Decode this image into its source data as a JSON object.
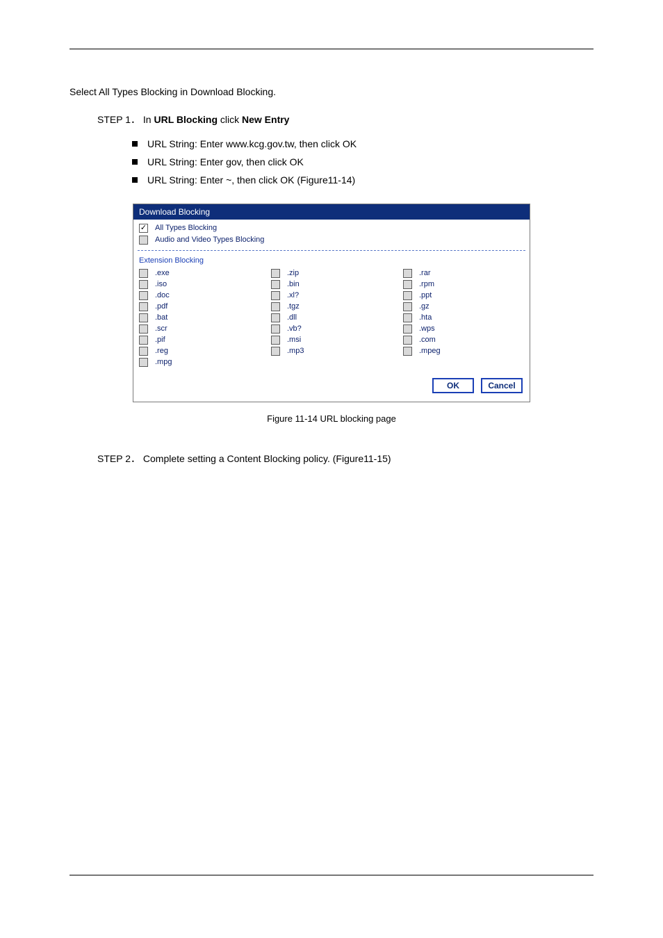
{
  "caption": "Figure 11-14  URL blocking page",
  "intro": "Select All Types Blocking in Download Blocking.",
  "step1": {
    "label": "STEP 1",
    "separator": "．",
    "text_before": "In ",
    "link": "URL Blocking",
    "text_after": " click ",
    "bold": "New Entry"
  },
  "substeps": [
    {
      "label": "URL String:",
      "value": "Enter www.kcg.gov.tw, then click OK"
    },
    {
      "label": "URL String:",
      "value": "Enter gov, then click OK"
    },
    {
      "label": "URL String:",
      "value": "Enter ~, then click OK  (Figure11-14)"
    }
  ],
  "step2": {
    "label": "STEP 2",
    "separator": "．",
    "text": "Complete setting a Content Blocking policy. (Figure11-15)"
  },
  "panel": {
    "title": "Download Blocking",
    "all_types": {
      "label": "All Types Blocking",
      "checked": true,
      "disabled": false
    },
    "audio_video": {
      "label": "Audio and Video Types Blocking",
      "checked": false,
      "disabled": true
    },
    "ext_title": "Extension Blocking",
    "extensions": [
      [
        ".exe",
        ".zip",
        ".rar"
      ],
      [
        ".iso",
        ".bin",
        ".rpm"
      ],
      [
        ".doc",
        ".xl?",
        ".ppt"
      ],
      [
        ".pdf",
        ".tgz",
        ".gz"
      ],
      [
        ".bat",
        ".dll",
        ".hta"
      ],
      [
        ".scr",
        ".vb?",
        ".wps"
      ],
      [
        ".pif",
        ".msi",
        ".com"
      ],
      [
        ".reg",
        ".mp3",
        ".mpeg"
      ],
      [
        ".mpg",
        "",
        ""
      ]
    ],
    "ok": "OK",
    "cancel": "Cancel"
  }
}
